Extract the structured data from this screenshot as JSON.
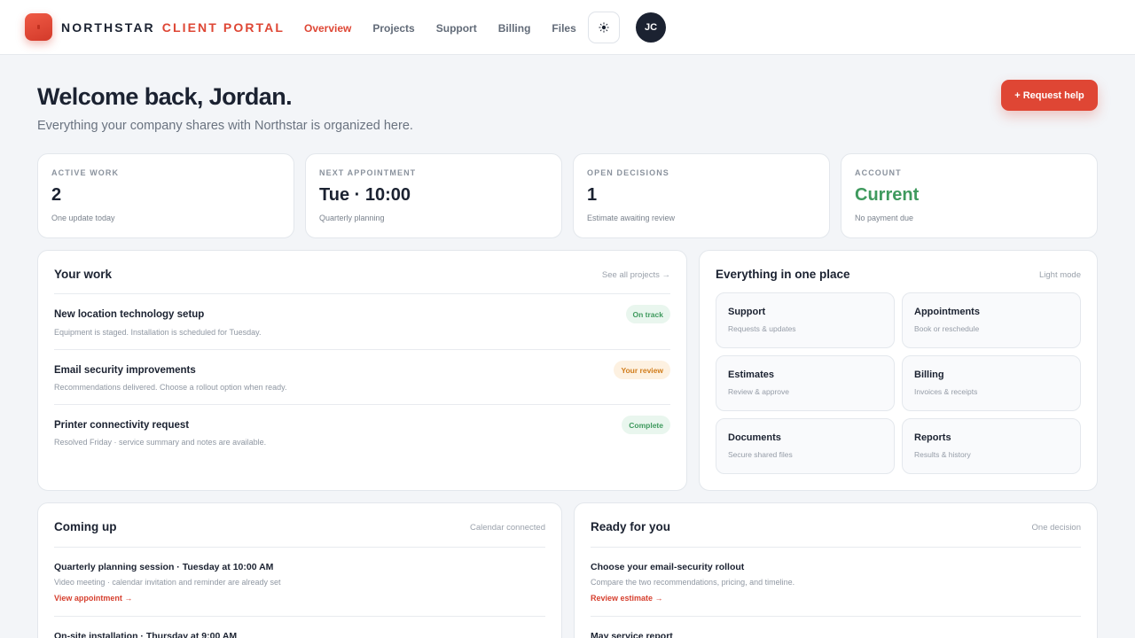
{
  "header": {
    "brand_name": "NORTHSTAR",
    "brand_suffix": "CLIENT PORTAL",
    "nav": [
      {
        "label": "Overview",
        "active": true
      },
      {
        "label": "Projects"
      },
      {
        "label": "Support"
      },
      {
        "label": "Billing"
      },
      {
        "label": "Files"
      }
    ],
    "theme_icon": "sun-icon",
    "avatar_initials": "JC"
  },
  "hero": {
    "title": "Welcome back, Jordan.",
    "subtitle": "Everything your company shares with Northstar is organized here.",
    "cta_label": "+ Request help"
  },
  "stats": [
    {
      "label": "ACTIVE WORK",
      "value": "2",
      "note": "One update today"
    },
    {
      "label": "NEXT APPOINTMENT",
      "value": "Tue · 10:00",
      "note": "Quarterly planning"
    },
    {
      "label": "OPEN DECISIONS",
      "value": "1",
      "note": "Estimate awaiting review"
    },
    {
      "label": "ACCOUNT",
      "value": "Current",
      "note": "No payment due",
      "value_color": "#3f9a5e"
    }
  ],
  "work": {
    "title": "Your work",
    "link": "See all projects →",
    "items": [
      {
        "title": "New location technology setup",
        "desc": "Equipment is staged. Installation is scheduled for Tuesday.",
        "status": "On track"
      },
      {
        "title": "Email security improvements",
        "desc": "Recommendations delivered. Choose a rollout option when ready.",
        "status": "Your review"
      },
      {
        "title": "Printer connectivity request",
        "desc": "Resolved Friday · service summary and notes are available.",
        "status": "Complete"
      }
    ]
  },
  "hub": {
    "title": "Everything in one place",
    "link": "Light mode",
    "tiles": [
      {
        "title": "Support",
        "sub": "Requests & updates"
      },
      {
        "title": "Appointments",
        "sub": "Book or reschedule"
      },
      {
        "title": "Estimates",
        "sub": "Review & approve"
      },
      {
        "title": "Billing",
        "sub": "Invoices & receipts"
      },
      {
        "title": "Documents",
        "sub": "Secure shared files"
      },
      {
        "title": "Reports",
        "sub": "Results & history"
      }
    ]
  },
  "coming_up": {
    "title": "Coming up",
    "link": "Calendar connected",
    "items": [
      {
        "title": "Quarterly planning session · Tuesday at 10:00 AM",
        "desc": "Video meeting · calendar invitation and reminder are already set",
        "cta": "View appointment →"
      },
      {
        "title": "On-site installation · Thursday at 9:00 AM"
      }
    ]
  },
  "ready": {
    "title": "Ready for you",
    "link": "One decision",
    "items": [
      {
        "title": "Choose your email-security rollout",
        "desc": "Compare the two recommendations, pricing, and timeline.",
        "cta": "Review estimate →"
      },
      {
        "title": "May service report"
      }
    ]
  },
  "colors": {
    "accent": "#de4634",
    "success": "#3f9a5e",
    "warning": "#d17d1c",
    "ink": "#1b2231"
  }
}
